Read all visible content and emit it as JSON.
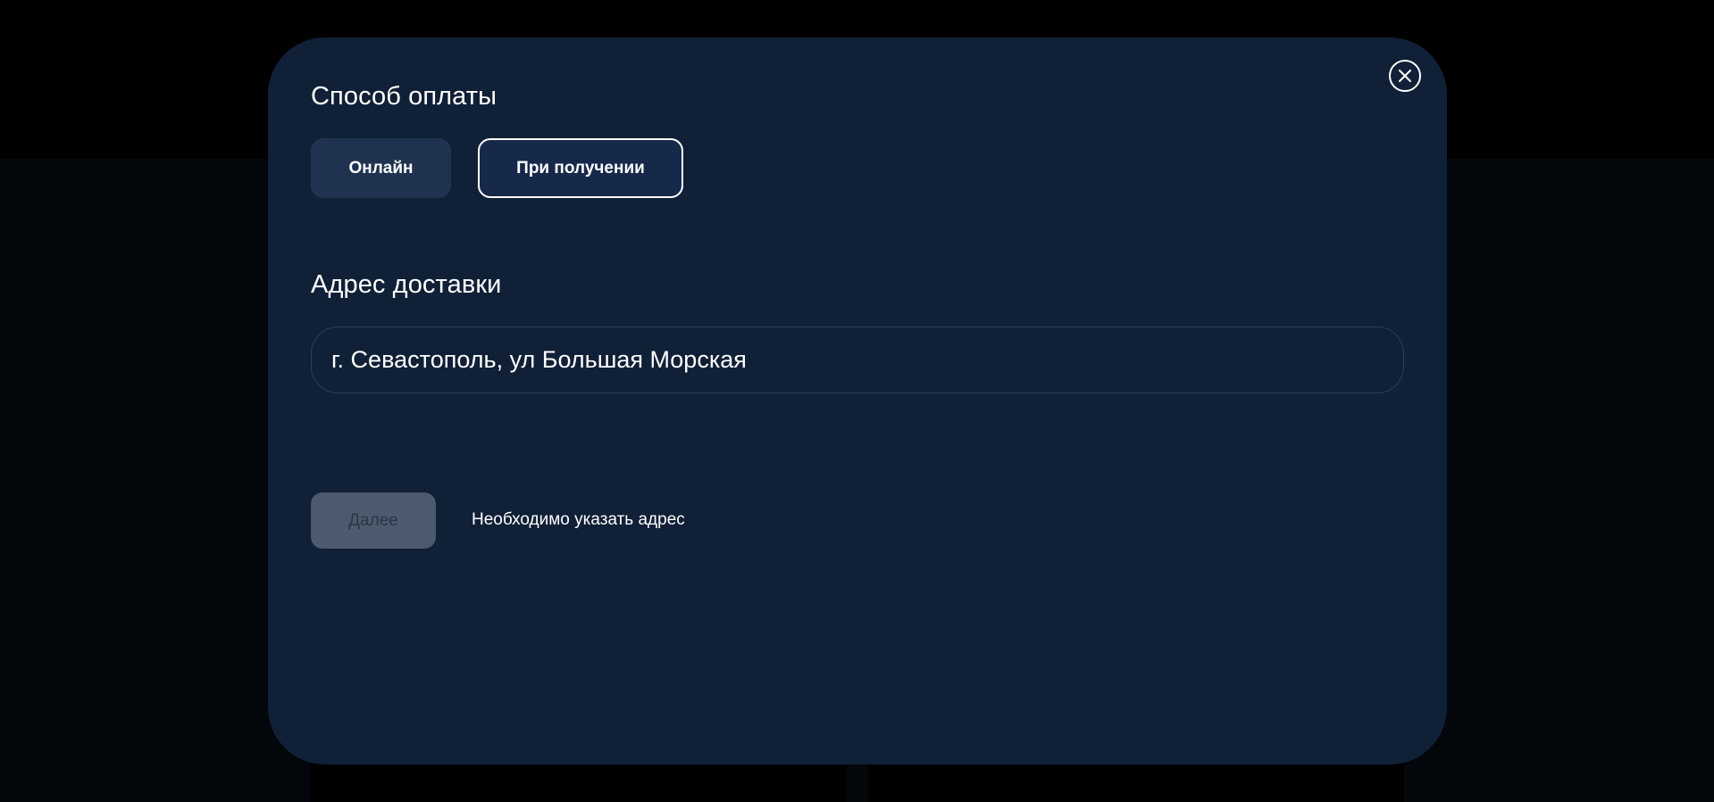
{
  "payment": {
    "title": "Способ оплаты",
    "options": [
      {
        "label": "Онлайн",
        "selected": false
      },
      {
        "label": "При получении",
        "selected": true
      }
    ]
  },
  "address": {
    "title": "Адрес доставки",
    "value": "г. Севастополь, ул Большая Морская"
  },
  "actions": {
    "next_label": "Далее",
    "next_enabled": false,
    "hint": "Необходимо указать адрес"
  },
  "icons": {
    "close": "close-icon"
  },
  "colors": {
    "modal_bg": "#102037",
    "option_bg": "#1f3350",
    "selected_border": "#ffffff",
    "disabled_button_bg": "#4c5a6d"
  }
}
